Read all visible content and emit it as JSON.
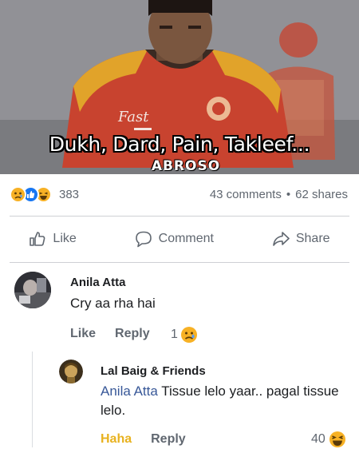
{
  "meme": {
    "caption": "Dukh, Dard, Pain, Takleef...",
    "watermark": "ABROSO",
    "jersey_logo": "Fast",
    "colors": {
      "jersey": "#c8432f",
      "jersey_yellow": "#e1a32a",
      "background": "#909095"
    }
  },
  "post_stats": {
    "reaction_icons": [
      "sad-emoji-icon",
      "like-thumb-icon",
      "haha-emoji-icon"
    ],
    "reaction_count": "383",
    "comments": "43 comments",
    "separator": "•",
    "shares": "62 shares"
  },
  "actions": {
    "like_label": "Like",
    "comment_label": "Comment",
    "share_label": "Share"
  },
  "comments": [
    {
      "author": "Anila Atta",
      "text": "Cry aa rha hai",
      "like_label": "Like",
      "reply_label": "Reply",
      "reaction_count": "1",
      "reaction_icon": "sad-emoji-icon"
    }
  ],
  "replies": [
    {
      "author": "Lal Baig & Friends",
      "mention": "Anila Atta",
      "text": " Tissue lelo yaar.. pagal tissue lelo.",
      "reaction_label": "Haha",
      "reply_label": "Reply",
      "reaction_count": "40",
      "reaction_icon": "haha-emoji-icon"
    }
  ],
  "colors": {
    "link": "#385898",
    "muted": "#606770",
    "haha": "#e8b21f",
    "like_blue": "#1877f2"
  }
}
